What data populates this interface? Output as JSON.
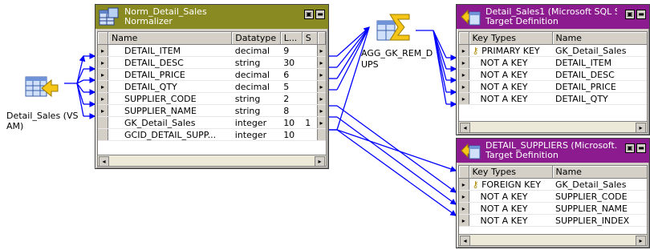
{
  "source": {
    "label": "Detail_Sales (VS AM)"
  },
  "normalizer": {
    "title": "Norm_Detail_Sales",
    "subtitle": "Normalizer",
    "columns": [
      "Name",
      "Datatype",
      "L...",
      "S"
    ],
    "rows": [
      {
        "name": "DETAIL_ITEM",
        "datatype": "decimal",
        "len": "9",
        "s": ""
      },
      {
        "name": "DETAIL_DESC",
        "datatype": "string",
        "len": "30",
        "s": ""
      },
      {
        "name": "DETAIL_PRICE",
        "datatype": "decimal",
        "len": "6",
        "s": ""
      },
      {
        "name": "DETAIL_QTY",
        "datatype": "decimal",
        "len": "5",
        "s": ""
      },
      {
        "name": "SUPPLIER_CODE",
        "datatype": "string",
        "len": "2",
        "s": ""
      },
      {
        "name": "SUPPLIER_NAME",
        "datatype": "string",
        "len": "8",
        "s": ""
      },
      {
        "name": "GK_Detail_Sales",
        "datatype": "integer",
        "len": "10",
        "s": "1"
      },
      {
        "name": "GCID_DETAIL_SUPP...",
        "datatype": "integer",
        "len": "10",
        "s": ""
      }
    ]
  },
  "aggregator": {
    "label": "AGG_GK_REM_DUPS"
  },
  "target1": {
    "title": "Detail_Sales1 (Microsoft SQL S...",
    "subtitle": "Target Definition",
    "columns": [
      "Key Types",
      "Name"
    ],
    "rows": [
      {
        "key": "PRIMARY KEY",
        "name": "GK_Detail_Sales"
      },
      {
        "key": "NOT A KEY",
        "name": "DETAIL_ITEM"
      },
      {
        "key": "NOT A KEY",
        "name": "DETAIL_DESC"
      },
      {
        "key": "NOT A KEY",
        "name": "DETAIL_PRICE"
      },
      {
        "key": "NOT A KEY",
        "name": "DETAIL_QTY"
      }
    ]
  },
  "target2": {
    "title": "DETAIL_SUPPLIERS (Microsoft...",
    "subtitle": "Target Definition",
    "columns": [
      "Key Types",
      "Name"
    ],
    "rows": [
      {
        "key": "FOREIGN KEY",
        "name": "GK_Detail_Sales"
      },
      {
        "key": "NOT A KEY",
        "name": "SUPPLIER_CODE"
      },
      {
        "key": "NOT A KEY",
        "name": "SUPPLIER_NAME"
      },
      {
        "key": "NOT A KEY",
        "name": "SUPPLIER_INDEX"
      }
    ]
  },
  "colors": {
    "normalizer_title": "#8a8a22",
    "target_title": "#8b1b8e",
    "link": "#0000ff",
    "canvas": "#ffffff"
  },
  "icons": {
    "source": "source-table-icon",
    "aggregator": "aggregator-sigma-icon",
    "key": "key-icon",
    "minimize": "minimize-icon",
    "restore": "restore-icon"
  }
}
